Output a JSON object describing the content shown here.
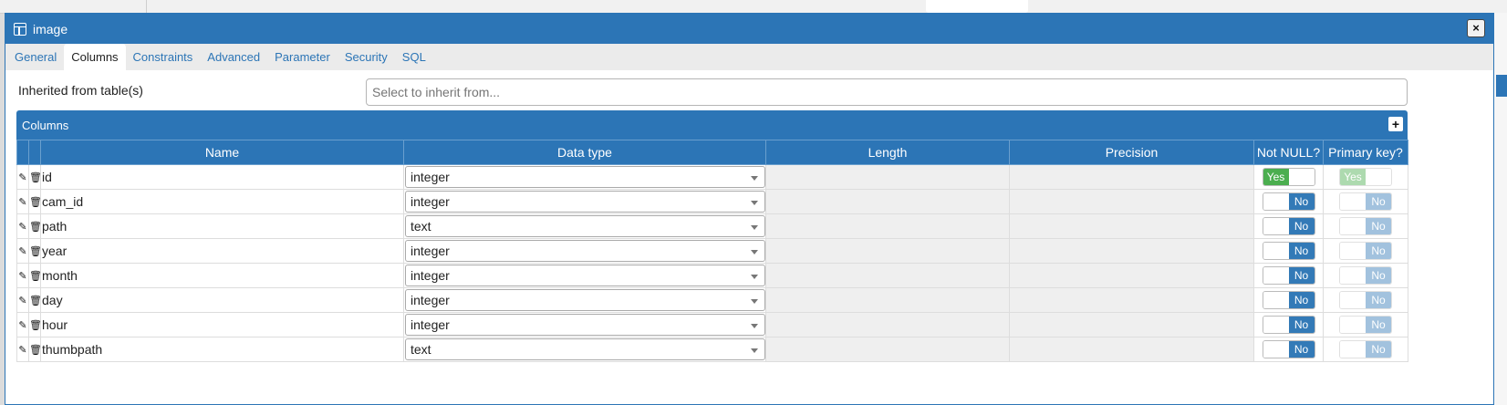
{
  "dialog": {
    "title": "image",
    "close_label": "×"
  },
  "tabs": [
    {
      "label": "General",
      "active": false
    },
    {
      "label": "Columns",
      "active": true
    },
    {
      "label": "Constraints",
      "active": false
    },
    {
      "label": "Advanced",
      "active": false
    },
    {
      "label": "Parameter",
      "active": false
    },
    {
      "label": "Security",
      "active": false
    },
    {
      "label": "SQL",
      "active": false
    }
  ],
  "inherit": {
    "label": "Inherited from table(s)",
    "placeholder": "Select to inherit from..."
  },
  "columns_panel": {
    "title": "Columns",
    "add_label": "+",
    "headers": {
      "name": "Name",
      "data_type": "Data type",
      "length": "Length",
      "precision": "Precision",
      "not_null": "Not NULL?",
      "primary_key": "Primary key?"
    },
    "rows": [
      {
        "name": "id",
        "data_type": "integer",
        "not_null": "Yes",
        "primary_key": "Yes"
      },
      {
        "name": "cam_id",
        "data_type": "integer",
        "not_null": "No",
        "primary_key": "No"
      },
      {
        "name": "path",
        "data_type": "text",
        "not_null": "No",
        "primary_key": "No"
      },
      {
        "name": "year",
        "data_type": "integer",
        "not_null": "No",
        "primary_key": "No"
      },
      {
        "name": "month",
        "data_type": "integer",
        "not_null": "No",
        "primary_key": "No"
      },
      {
        "name": "day",
        "data_type": "integer",
        "not_null": "No",
        "primary_key": "No"
      },
      {
        "name": "hour",
        "data_type": "integer",
        "not_null": "No",
        "primary_key": "No"
      },
      {
        "name": "thumbpath",
        "data_type": "text",
        "not_null": "No",
        "primary_key": "No"
      }
    ]
  },
  "colors": {
    "accent": "#2c75b6",
    "toggle_yes": "#4bae4f",
    "toggle_no": "#337ab7"
  }
}
